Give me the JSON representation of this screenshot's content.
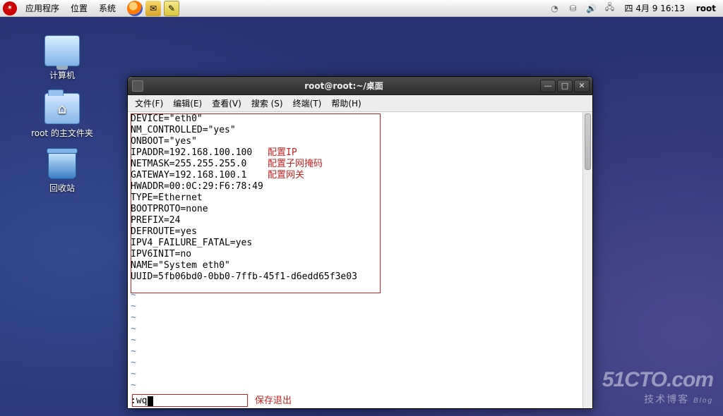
{
  "panel": {
    "menus": {
      "apps": "应用程序",
      "places": "位置",
      "system": "系统"
    },
    "clock": "四 4月  9 16:13",
    "user": "root"
  },
  "desktop": {
    "computer": "计算机",
    "home": "root 的主文件夹",
    "trash": "回收站"
  },
  "window": {
    "title": "root@root:~/桌面",
    "menus": {
      "file": "文件(F)",
      "edit": "编辑(E)",
      "view": "查看(V)",
      "search": "搜索 (S)",
      "terminal": "终端(T)",
      "help": "帮助(H)"
    }
  },
  "terminal": {
    "lines": [
      "DEVICE=\"eth0\"",
      "NM_CONTROLLED=\"yes\"",
      "ONBOOT=\"yes\"",
      "IPADDR=192.168.100.100",
      "NETMASK=255.255.255.0",
      "GATEWAY=192.168.100.1",
      "HWADDR=00:0C:29:F6:78:49",
      "TYPE=Ethernet",
      "BOOTPROTO=none",
      "PREFIX=24",
      "DEFROUTE=yes",
      "IPV4_FAILURE_FATAL=yes",
      "IPV6INIT=no",
      "NAME=\"System eth0\"",
      "UUID=5fb06bd0-0bb0-7ffb-45f1-d6edd65f3e03"
    ],
    "annotations": {
      "ip": "配置IP",
      "netmask": "配置子网掩码",
      "gateway": "配置网关",
      "save": "保存退出"
    },
    "command": ":wq"
  },
  "watermark": {
    "brand": "51CTO.com",
    "tagline": "技术博客",
    "suffix": "Blog"
  }
}
